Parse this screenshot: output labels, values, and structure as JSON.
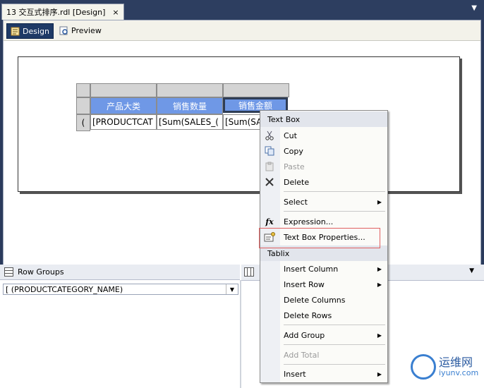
{
  "tab": {
    "title": "13 交互式排序.rdl [Design]",
    "close": "×",
    "overflow": "▼"
  },
  "toolbar": {
    "design_label": "Design",
    "preview_label": "Preview"
  },
  "tablix": {
    "headers": [
      "产品大类",
      "销售数量",
      "销售金额"
    ],
    "row_marker": "(",
    "cells": [
      "[PRODUCTCAT",
      "[Sum(SALES_(",
      "[Sum(SA"
    ]
  },
  "groups": {
    "row_groups_label": "Row Groups",
    "row_group_item": "[ (PRODUCTCATEGORY_NAME)",
    "dropdown_arrow": "▼",
    "col_panel_arrow": "▼"
  },
  "context_menu": {
    "section_textbox": "Text Box",
    "cut": "Cut",
    "copy": "Copy",
    "paste": "Paste",
    "delete": "Delete",
    "select": "Select",
    "expression": "Expression...",
    "textbox_properties": "Text Box Properties...",
    "section_tablix": "Tablix",
    "insert_column": "Insert Column",
    "insert_row": "Insert Row",
    "delete_columns": "Delete Columns",
    "delete_rows": "Delete Rows",
    "add_group": "Add Group",
    "add_total": "Add Total",
    "insert": "Insert",
    "submenu_arrow": "▶",
    "expression_glyph": "fx"
  },
  "watermark": {
    "name": "运维网",
    "url": "iyunv.com"
  },
  "colors": {
    "header_blue": "#6f98e6",
    "menu_highlight_border": "#e06060",
    "tab_bg": "#2d3e60"
  }
}
